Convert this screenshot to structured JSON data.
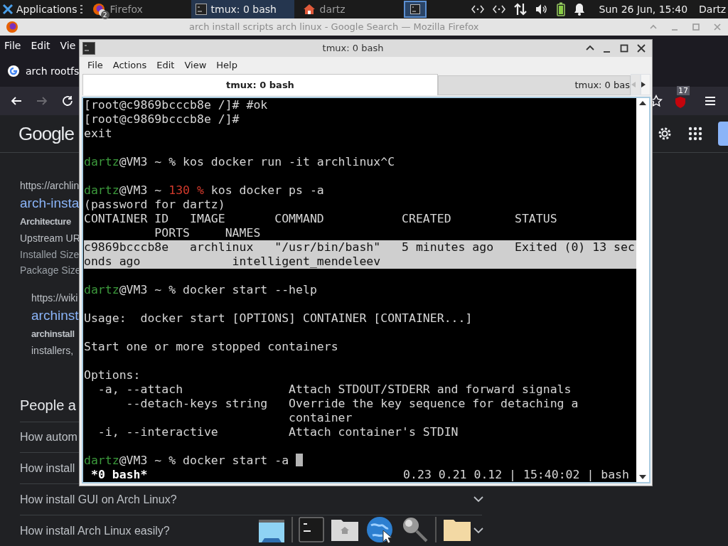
{
  "top_panel": {
    "apps_label": "Applications",
    "tasks": [
      {
        "kind": "browser",
        "label": "Firefox",
        "badge": "2",
        "selected": false
      },
      {
        "kind": "terminal",
        "label": "tmux: 0 bash",
        "selected": true
      },
      {
        "kind": "home",
        "label": "dartz",
        "selected": false
      }
    ],
    "clock": "Sun 26 Jun, 15:40",
    "user": "Dartz"
  },
  "firefox": {
    "title": "arch install scripts arch linux - Google Search — Mozilla Firefox",
    "menu": [
      "File",
      "Edit",
      "Vie"
    ],
    "tab": "arch rootfs",
    "extension_badge": "17",
    "logo": "Google",
    "results": [
      {
        "url": "https://archlin",
        "link": "arch-insta",
        "lines": [
          {
            "kind": "bold",
            "text": "Architecture"
          },
          {
            "kind": "text",
            "text": "Upstream UR"
          },
          {
            "kind": "meta",
            "text": "Installed Size"
          },
          {
            "kind": "meta",
            "text": "Package Size"
          }
        ],
        "children": [
          {
            "url": "https://wiki",
            "link": "archinst",
            "lines": [
              {
                "kind": "bold",
                "text": "archinstall"
              },
              {
                "kind": "text",
                "text": "installers,"
              }
            ]
          }
        ]
      }
    ],
    "people_heading": "People a",
    "questions": [
      {
        "text": "How autom",
        "chevron": false
      },
      {
        "text": "How install",
        "chevron": false
      },
      {
        "text": "How install GUI on Arch Linux?",
        "chevron": true
      },
      {
        "text": "How install Arch Linux easily?",
        "chevron": true
      }
    ]
  },
  "terminal": {
    "title": "tmux: 0 bash",
    "menu": [
      "File",
      "Actions",
      "Edit",
      "View",
      "Help"
    ],
    "tabs": [
      {
        "label": "tmux: 0 bash",
        "selected": true
      },
      {
        "label": "tmux: 0 bas",
        "selected": false
      }
    ],
    "lines": [
      {
        "kind": "text",
        "selected": false,
        "segments": [
          {
            "kind": "plain",
            "text": "[root@c9869bcccb8e /]# #ok"
          }
        ]
      },
      {
        "kind": "text",
        "selected": false,
        "segments": [
          {
            "kind": "plain",
            "text": "[root@c9869bcccb8e /]#"
          }
        ]
      },
      {
        "kind": "text",
        "selected": false,
        "segments": [
          {
            "kind": "plain",
            "text": "exit"
          }
        ]
      },
      {
        "kind": "blank"
      },
      {
        "kind": "text",
        "selected": false,
        "segments": [
          {
            "kind": "user",
            "text": "dartz"
          },
          {
            "kind": "plain",
            "text": "@VM3 ~ % kos docker run -it archlinux^C"
          }
        ]
      },
      {
        "kind": "blank"
      },
      {
        "kind": "text",
        "selected": false,
        "segments": [
          {
            "kind": "user",
            "text": "dartz"
          },
          {
            "kind": "plain",
            "text": "@VM3 ~ "
          },
          {
            "kind": "error",
            "text": "130 %"
          },
          {
            "kind": "plain",
            "text": " kos docker ps -a"
          }
        ]
      },
      {
        "kind": "text",
        "selected": false,
        "segments": [
          {
            "kind": "plain",
            "text": "(password for dartz)"
          }
        ]
      },
      {
        "kind": "text",
        "selected": false,
        "segments": [
          {
            "kind": "plain",
            "text": "CONTAINER ID   IMAGE       COMMAND           CREATED         STATUS"
          }
        ]
      },
      {
        "kind": "text",
        "selected": false,
        "segments": [
          {
            "kind": "plain",
            "text": "          PORTS     NAMES"
          }
        ]
      },
      {
        "kind": "text",
        "selected": true,
        "segments": [
          {
            "kind": "plain",
            "text": "c9869bcccb8e   archlinux   \"/usr/bin/bash\"   5 minutes ago   Exited (0) 13 sec"
          }
        ]
      },
      {
        "kind": "text",
        "selected": true,
        "segments": [
          {
            "kind": "plain",
            "text": "onds ago             intelligent_mendeleev"
          }
        ]
      },
      {
        "kind": "blank"
      },
      {
        "kind": "text",
        "selected": false,
        "segments": [
          {
            "kind": "user",
            "text": "dartz"
          },
          {
            "kind": "plain",
            "text": "@VM3 ~ % docker start --help"
          }
        ]
      },
      {
        "kind": "blank"
      },
      {
        "kind": "text",
        "selected": false,
        "segments": [
          {
            "kind": "plain",
            "text": "Usage:  docker start [OPTIONS] CONTAINER [CONTAINER...]"
          }
        ]
      },
      {
        "kind": "blank"
      },
      {
        "kind": "text",
        "selected": false,
        "segments": [
          {
            "kind": "plain",
            "text": "Start one or more stopped containers"
          }
        ]
      },
      {
        "kind": "blank"
      },
      {
        "kind": "text",
        "selected": false,
        "segments": [
          {
            "kind": "plain",
            "text": "Options:"
          }
        ]
      },
      {
        "kind": "text",
        "selected": false,
        "segments": [
          {
            "kind": "plain",
            "text": "  -a, --attach               Attach STDOUT/STDERR and forward signals"
          }
        ]
      },
      {
        "kind": "text",
        "selected": false,
        "segments": [
          {
            "kind": "plain",
            "text": "      --detach-keys string   Override the key sequence for detaching a"
          }
        ]
      },
      {
        "kind": "text",
        "selected": false,
        "segments": [
          {
            "kind": "plain",
            "text": "                             container"
          }
        ]
      },
      {
        "kind": "text",
        "selected": false,
        "segments": [
          {
            "kind": "plain",
            "text": "  -i, --interactive          Attach container's STDIN"
          }
        ]
      },
      {
        "kind": "blank"
      },
      {
        "kind": "text",
        "selected": false,
        "cursor": true,
        "segments": [
          {
            "kind": "user",
            "text": "dartz"
          },
          {
            "kind": "plain",
            "text": "@VM3 ~ % docker start -a"
          }
        ]
      }
    ],
    "status_left": "*0 bash*",
    "status_right": "0.23 0.21 0.12 | 15:40:02 | bash"
  }
}
